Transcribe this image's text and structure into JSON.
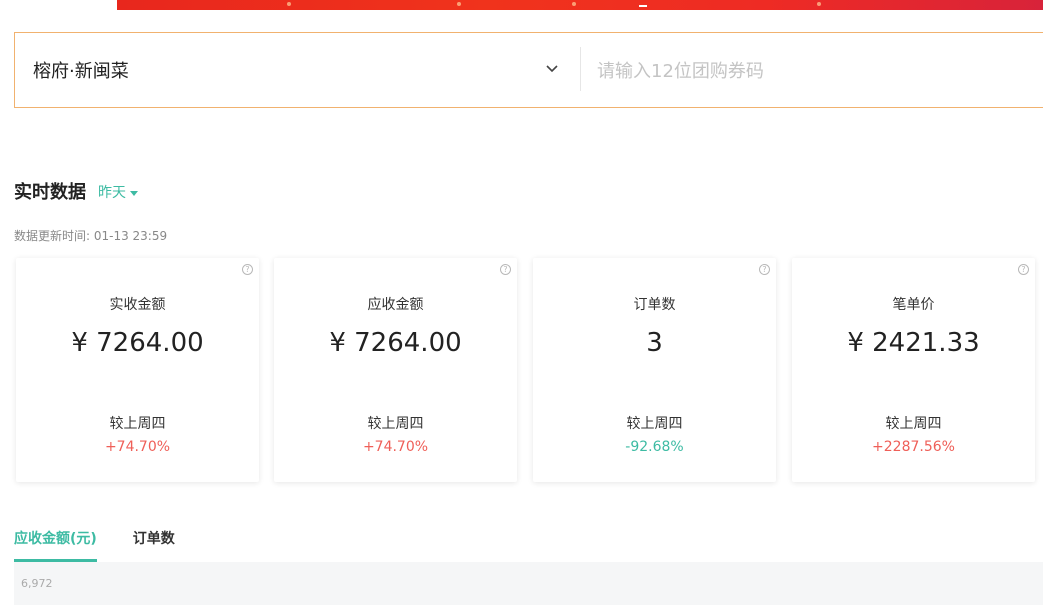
{
  "search": {
    "store_name": "榕府·新闽菜",
    "coupon_placeholder": "请输入12位团购券码"
  },
  "realtime": {
    "title": "实时数据",
    "date_filter": "昨天",
    "update_time": "数据更新时间: 01-13 23:59"
  },
  "cards": [
    {
      "label": "实收金额",
      "value": "¥ 7264.00",
      "compare": "较上周四",
      "change": "+74.70%"
    },
    {
      "label": "应收金额",
      "value": "¥ 7264.00",
      "compare": "较上周四",
      "change": "+74.70%"
    },
    {
      "label": "订单数",
      "value": "3",
      "compare": "较上周四",
      "change": "-92.68%"
    },
    {
      "label": "笔单价",
      "value": "¥ 2421.33",
      "compare": "较上周四",
      "change": "+2287.56%"
    }
  ],
  "tabs": [
    {
      "label": "应收金额(元)",
      "active": true
    },
    {
      "label": "订单数",
      "active": false
    }
  ],
  "chart": {
    "top_value": "6,972"
  },
  "colors": {
    "accent": "#3dbba3",
    "up": "#ef5f58",
    "down": "#3dbba3",
    "search_border": "#f1b26f"
  }
}
